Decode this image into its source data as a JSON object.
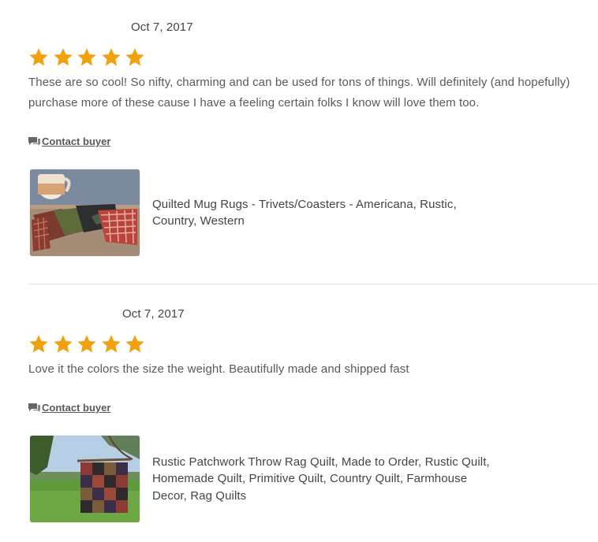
{
  "reviews": [
    {
      "date": "Oct 7, 2017",
      "rating": 5,
      "text": "These are so cool! So nifty, charming and can be used for tons of things. Will definitely (and hopefully) purchase more of these cause I have a feeling certain folks I know will love them too.",
      "contact_label": "Contact buyer",
      "listing_title": "Quilted Mug Rugs - Trivets/Coasters - Americana, Rustic, Country, Western"
    },
    {
      "date": "Oct 7, 2017",
      "rating": 5,
      "text": "Love it the colors the size the weight. Beautifully made and shipped fast",
      "contact_label": "Contact buyer",
      "listing_title": "Rustic Patchwork Throw Rag Quilt, Made to Order, Rustic Quilt, Homemade Quilt, Primitive Quilt, Country Quilt, Farmhouse Decor, Rag Quilts"
    }
  ],
  "colors": {
    "star": "#f1a10d",
    "text": "#595959",
    "divider": "#e1e1e1"
  },
  "icons": {
    "star": "star-icon",
    "contact": "message-icon"
  }
}
